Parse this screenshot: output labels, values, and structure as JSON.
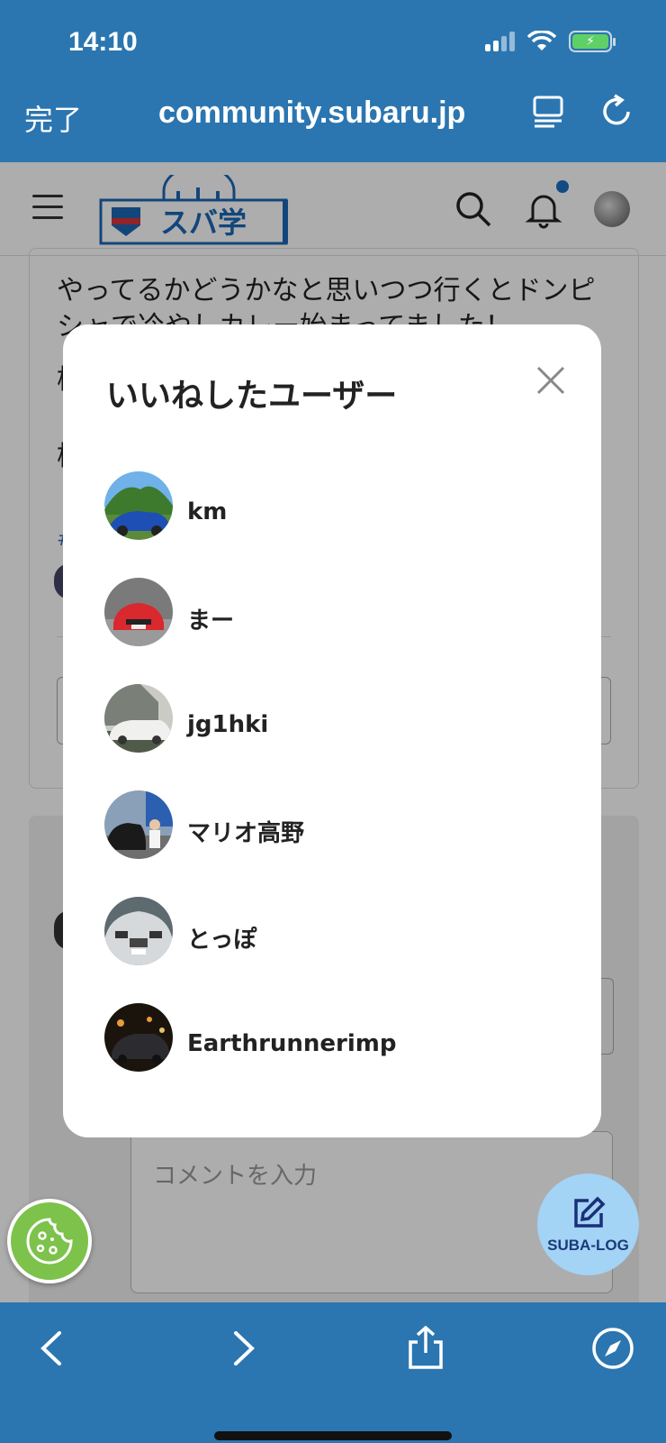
{
  "status_bar": {
    "time": "14:10"
  },
  "browser": {
    "done_label": "完了",
    "url": "community.subaru.jp"
  },
  "site": {
    "logo_text": "スバ学"
  },
  "background_post": {
    "line1": "やってるかどうかなと思いつつ行くとドンピ",
    "line2": "シャで冷やしカレー始まってました！",
    "line3": "柿",
    "line4": "柿",
    "hash": "#",
    "comment_placeholder": "コメントを入力"
  },
  "modal": {
    "title": "いいねしたユーザー",
    "users": [
      {
        "name": "km",
        "avatar": "blue-car-mountain"
      },
      {
        "name": "まー",
        "avatar": "red-car-front"
      },
      {
        "name": "jg1hki",
        "avatar": "white-sedan-garage"
      },
      {
        "name": "マリオ高野",
        "avatar": "black-car-person"
      },
      {
        "name": "とっぽ",
        "avatar": "silver-impreza-front"
      },
      {
        "name": "Earthrunnerimp",
        "avatar": "car-night"
      }
    ]
  },
  "fab": {
    "subalog_label": "SUBA-LOG"
  },
  "colors": {
    "safari_bar": "#2b76b0",
    "cookie_green": "#7dc24b",
    "subalog_bg": "#a3d3f5"
  }
}
